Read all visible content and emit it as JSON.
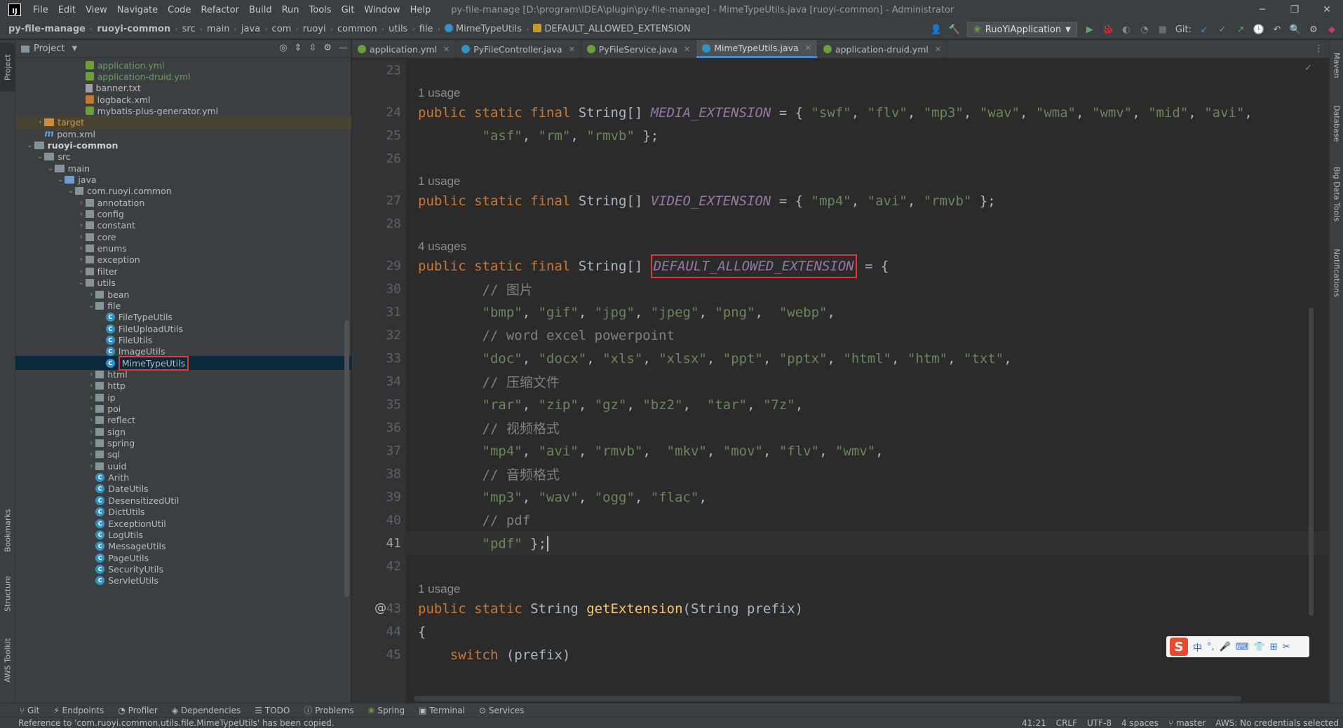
{
  "menu": [
    "File",
    "Edit",
    "View",
    "Navigate",
    "Code",
    "Refactor",
    "Build",
    "Run",
    "Tools",
    "Git",
    "Window",
    "Help"
  ],
  "window": {
    "title": "py-file-manage [D:\\program\\IDEA\\plugin\\py-file-manage] - MimeTypeUtils.java [ruoyi-common] - Administrator",
    "logo_letters": "IJ"
  },
  "breadcrumb": [
    "py-file-manage",
    "ruoyi-common",
    "src",
    "main",
    "java",
    "com",
    "ruoyi",
    "common",
    "utils",
    "file",
    "MimeTypeUtils",
    "DEFAULT_ALLOWED_EXTENSION"
  ],
  "toolbar": {
    "run_config": "RuoYiApplication",
    "git_label": "Git:"
  },
  "project_panel": {
    "title": "Project"
  },
  "left_tool_tabs": [
    "Project",
    "Bookmarks",
    "Structure",
    "AWS Toolkit"
  ],
  "right_tool_tabs": [
    "Maven",
    "Database",
    "Big Data Tools",
    "Notifications"
  ],
  "tree": [
    {
      "label": "application.yml",
      "icon": "yml-icon",
      "indent": 6,
      "style": "green"
    },
    {
      "label": "application-druid.yml",
      "icon": "yml-icon",
      "indent": 6,
      "style": "green"
    },
    {
      "label": "banner.txt",
      "icon": "text-file-icon",
      "indent": 6,
      "style": ""
    },
    {
      "label": "logback.xml",
      "icon": "xml-icon",
      "indent": 6,
      "style": ""
    },
    {
      "label": "mybatis-plus-generator.yml",
      "icon": "yml-icon",
      "indent": 6,
      "style": ""
    },
    {
      "label": "target",
      "icon": "folder-orange-icon",
      "indent": 2,
      "style": "orange",
      "arrow": "›",
      "ignored": true
    },
    {
      "label": "pom.xml",
      "icon": "maven-icon",
      "indent": 2,
      "style": ""
    },
    {
      "label": "ruoyi-common",
      "icon": "module-folder-icon",
      "indent": 1,
      "style": "bold",
      "arrow": "⌄"
    },
    {
      "label": "src",
      "icon": "folder-icon",
      "indent": 2,
      "style": "",
      "arrow": "⌄"
    },
    {
      "label": "main",
      "icon": "folder-icon",
      "indent": 3,
      "style": "",
      "arrow": "⌄"
    },
    {
      "label": "java",
      "icon": "folder-blue-icon",
      "indent": 4,
      "style": "",
      "arrow": "⌄"
    },
    {
      "label": "com.ruoyi.common",
      "icon": "package-icon",
      "indent": 5,
      "style": "",
      "arrow": "⌄"
    },
    {
      "label": "annotation",
      "icon": "package-icon",
      "indent": 6,
      "style": "",
      "arrow": "›"
    },
    {
      "label": "config",
      "icon": "package-icon",
      "indent": 6,
      "style": "",
      "arrow": "›"
    },
    {
      "label": "constant",
      "icon": "package-icon",
      "indent": 6,
      "style": "",
      "arrow": "›"
    },
    {
      "label": "core",
      "icon": "package-icon",
      "indent": 6,
      "style": "",
      "arrow": "›"
    },
    {
      "label": "enums",
      "icon": "package-icon",
      "indent": 6,
      "style": "",
      "arrow": "›"
    },
    {
      "label": "exception",
      "icon": "package-icon",
      "indent": 6,
      "style": "",
      "arrow": "›"
    },
    {
      "label": "filter",
      "icon": "package-icon",
      "indent": 6,
      "style": "",
      "arrow": "›"
    },
    {
      "label": "utils",
      "icon": "package-icon",
      "indent": 6,
      "style": "",
      "arrow": "⌄"
    },
    {
      "label": "bean",
      "icon": "package-icon",
      "indent": 7,
      "style": "",
      "arrow": "›"
    },
    {
      "label": "file",
      "icon": "package-icon",
      "indent": 7,
      "style": "",
      "arrow": "⌄"
    },
    {
      "label": "FileTypeUtils",
      "icon": "class-icon",
      "indent": 8,
      "style": ""
    },
    {
      "label": "FileUploadUtils",
      "icon": "class-icon",
      "indent": 8,
      "style": ""
    },
    {
      "label": "FileUtils",
      "icon": "class-icon",
      "indent": 8,
      "style": ""
    },
    {
      "label": "ImageUtils",
      "icon": "class-icon",
      "indent": 8,
      "style": ""
    },
    {
      "label": "MimeTypeUtils",
      "icon": "class-icon",
      "indent": 8,
      "style": "",
      "selected": true,
      "boxed": true
    },
    {
      "label": "html",
      "icon": "package-icon",
      "indent": 7,
      "style": "",
      "arrow": "›"
    },
    {
      "label": "http",
      "icon": "package-icon",
      "indent": 7,
      "style": "",
      "arrow": "›"
    },
    {
      "label": "ip",
      "icon": "package-icon",
      "indent": 7,
      "style": "",
      "arrow": "›"
    },
    {
      "label": "poi",
      "icon": "package-icon",
      "indent": 7,
      "style": "",
      "arrow": "›"
    },
    {
      "label": "reflect",
      "icon": "package-icon",
      "indent": 7,
      "style": "",
      "arrow": "›"
    },
    {
      "label": "sign",
      "icon": "package-icon",
      "indent": 7,
      "style": "",
      "arrow": "›"
    },
    {
      "label": "spring",
      "icon": "package-icon",
      "indent": 7,
      "style": "",
      "arrow": "›"
    },
    {
      "label": "sql",
      "icon": "package-icon",
      "indent": 7,
      "style": "",
      "arrow": "›"
    },
    {
      "label": "uuid",
      "icon": "package-icon",
      "indent": 7,
      "style": "",
      "arrow": "›"
    },
    {
      "label": "Arith",
      "icon": "class-icon",
      "indent": 7,
      "style": ""
    },
    {
      "label": "DateUtils",
      "icon": "class-icon",
      "indent": 7,
      "style": ""
    },
    {
      "label": "DesensitizedUtil",
      "icon": "class-icon",
      "indent": 7,
      "style": ""
    },
    {
      "label": "DictUtils",
      "icon": "class-icon",
      "indent": 7,
      "style": ""
    },
    {
      "label": "ExceptionUtil",
      "icon": "class-icon",
      "indent": 7,
      "style": ""
    },
    {
      "label": "LogUtils",
      "icon": "class-icon",
      "indent": 7,
      "style": ""
    },
    {
      "label": "MessageUtils",
      "icon": "class-icon",
      "indent": 7,
      "style": ""
    },
    {
      "label": "PageUtils",
      "icon": "class-icon",
      "indent": 7,
      "style": ""
    },
    {
      "label": "SecurityUtils",
      "icon": "class-icon",
      "indent": 7,
      "style": ""
    },
    {
      "label": "ServletUtils",
      "icon": "class-icon",
      "indent": 7,
      "style": ""
    }
  ],
  "tabs": [
    {
      "label": "application.yml",
      "icon": "yml-icon",
      "color": "#6a9f3a"
    },
    {
      "label": "PyFileController.java",
      "icon": "class-icon",
      "color": "#3592c4"
    },
    {
      "label": "PyFileService.java",
      "icon": "interface-icon",
      "color": "#6a9f3a"
    },
    {
      "label": "MimeTypeUtils.java",
      "icon": "class-icon",
      "color": "#3592c4",
      "active": true
    },
    {
      "label": "application-druid.yml",
      "icon": "yml-icon",
      "color": "#6a9f3a"
    }
  ],
  "code": {
    "usages": [
      {
        "before_line": "24",
        "text": "1 usage"
      },
      {
        "before_line": "27",
        "text": "1 usage"
      },
      {
        "before_line": "29",
        "text": "4 usages"
      },
      {
        "before_line": "43",
        "text": "1 usage"
      }
    ],
    "lines": [
      {
        "n": "23",
        "tokens": []
      },
      {
        "n": "24",
        "tokens": [
          [
            "kw",
            "public static final "
          ],
          [
            "p",
            "String[] "
          ],
          [
            "const",
            "MEDIA_EXTENSION"
          ],
          [
            "p",
            " = { "
          ],
          [
            "str",
            "\"swf\""
          ],
          [
            "p",
            ", "
          ],
          [
            "str",
            "\"flv\""
          ],
          [
            "p",
            ", "
          ],
          [
            "str",
            "\"mp3\""
          ],
          [
            "p",
            ", "
          ],
          [
            "str",
            "\"wav\""
          ],
          [
            "p",
            ", "
          ],
          [
            "str",
            "\"wma\""
          ],
          [
            "p",
            ", "
          ],
          [
            "str",
            "\"wmv\""
          ],
          [
            "p",
            ", "
          ],
          [
            "str",
            "\"mid\""
          ],
          [
            "p",
            ", "
          ],
          [
            "str",
            "\"avi\""
          ],
          [
            "p",
            ","
          ]
        ]
      },
      {
        "n": "25",
        "tokens": [
          [
            "p",
            "        "
          ],
          [
            "str",
            "\"asf\""
          ],
          [
            "p",
            ", "
          ],
          [
            "str",
            "\"rm\""
          ],
          [
            "p",
            ", "
          ],
          [
            "str",
            "\"rmvb\""
          ],
          [
            "p",
            " };"
          ]
        ]
      },
      {
        "n": "26",
        "tokens": []
      },
      {
        "n": "27",
        "tokens": [
          [
            "kw",
            "public static final "
          ],
          [
            "p",
            "String[] "
          ],
          [
            "const",
            "VIDEO_EXTENSION"
          ],
          [
            "p",
            " = { "
          ],
          [
            "str",
            "\"mp4\""
          ],
          [
            "p",
            ", "
          ],
          [
            "str",
            "\"avi\""
          ],
          [
            "p",
            ", "
          ],
          [
            "str",
            "\"rmvb\""
          ],
          [
            "p",
            " };"
          ]
        ]
      },
      {
        "n": "28",
        "tokens": []
      },
      {
        "n": "29",
        "tokens": [
          [
            "kw",
            "public static final "
          ],
          [
            "p",
            "String[] "
          ],
          [
            "boxconst",
            "DEFAULT_ALLOWED_EXTENSION"
          ],
          [
            "p",
            " = {"
          ]
        ]
      },
      {
        "n": "30",
        "tokens": [
          [
            "p",
            "        "
          ],
          [
            "cmt",
            "// 图片"
          ]
        ]
      },
      {
        "n": "31",
        "tokens": [
          [
            "p",
            "        "
          ],
          [
            "str",
            "\"bmp\""
          ],
          [
            "p",
            ", "
          ],
          [
            "str",
            "\"gif\""
          ],
          [
            "p",
            ", "
          ],
          [
            "str",
            "\"jpg\""
          ],
          [
            "p",
            ", "
          ],
          [
            "str",
            "\"jpeg\""
          ],
          [
            "p",
            ", "
          ],
          [
            "str",
            "\"png\""
          ],
          [
            "p",
            ",  "
          ],
          [
            "str",
            "\"webp\""
          ],
          [
            "p",
            ","
          ]
        ]
      },
      {
        "n": "32",
        "tokens": [
          [
            "p",
            "        "
          ],
          [
            "cmt",
            "// word excel powerpoint"
          ]
        ]
      },
      {
        "n": "33",
        "tokens": [
          [
            "p",
            "        "
          ],
          [
            "str",
            "\"doc\""
          ],
          [
            "p",
            ", "
          ],
          [
            "str",
            "\"docx\""
          ],
          [
            "p",
            ", "
          ],
          [
            "str",
            "\"xls\""
          ],
          [
            "p",
            ", "
          ],
          [
            "str",
            "\"xlsx\""
          ],
          [
            "p",
            ", "
          ],
          [
            "str",
            "\"ppt\""
          ],
          [
            "p",
            ", "
          ],
          [
            "str",
            "\"pptx\""
          ],
          [
            "p",
            ", "
          ],
          [
            "str",
            "\"html\""
          ],
          [
            "p",
            ", "
          ],
          [
            "str",
            "\"htm\""
          ],
          [
            "p",
            ", "
          ],
          [
            "str",
            "\"txt\""
          ],
          [
            "p",
            ","
          ]
        ]
      },
      {
        "n": "34",
        "tokens": [
          [
            "p",
            "        "
          ],
          [
            "cmt",
            "// 压缩文件"
          ]
        ]
      },
      {
        "n": "35",
        "tokens": [
          [
            "p",
            "        "
          ],
          [
            "str",
            "\"rar\""
          ],
          [
            "p",
            ", "
          ],
          [
            "str",
            "\"zip\""
          ],
          [
            "p",
            ", "
          ],
          [
            "str",
            "\"gz\""
          ],
          [
            "p",
            ", "
          ],
          [
            "str",
            "\"bz2\""
          ],
          [
            "p",
            ",  "
          ],
          [
            "str",
            "\"tar\""
          ],
          [
            "p",
            ", "
          ],
          [
            "str",
            "\"7z\""
          ],
          [
            "p",
            ","
          ]
        ]
      },
      {
        "n": "36",
        "tokens": [
          [
            "p",
            "        "
          ],
          [
            "cmt",
            "// 视频格式"
          ]
        ]
      },
      {
        "n": "37",
        "tokens": [
          [
            "p",
            "        "
          ],
          [
            "str",
            "\"mp4\""
          ],
          [
            "p",
            ", "
          ],
          [
            "str",
            "\"avi\""
          ],
          [
            "p",
            ", "
          ],
          [
            "str",
            "\"rmvb\""
          ],
          [
            "p",
            ",  "
          ],
          [
            "str",
            "\"mkv\""
          ],
          [
            "p",
            ", "
          ],
          [
            "str",
            "\"mov\""
          ],
          [
            "p",
            ", "
          ],
          [
            "str",
            "\"flv\""
          ],
          [
            "p",
            ", "
          ],
          [
            "str",
            "\"wmv\""
          ],
          [
            "p",
            ","
          ]
        ]
      },
      {
        "n": "38",
        "tokens": [
          [
            "p",
            "        "
          ],
          [
            "cmt",
            "// 音频格式"
          ]
        ]
      },
      {
        "n": "39",
        "tokens": [
          [
            "p",
            "        "
          ],
          [
            "str",
            "\"mp3\""
          ],
          [
            "p",
            ", "
          ],
          [
            "str",
            "\"wav\""
          ],
          [
            "p",
            ", "
          ],
          [
            "str",
            "\"ogg\""
          ],
          [
            "p",
            ", "
          ],
          [
            "str",
            "\"flac\""
          ],
          [
            "p",
            ","
          ]
        ]
      },
      {
        "n": "40",
        "tokens": [
          [
            "p",
            "        "
          ],
          [
            "cmt",
            "// pdf"
          ]
        ]
      },
      {
        "n": "41",
        "tokens": [
          [
            "p",
            "        "
          ],
          [
            "str",
            "\"pdf\""
          ],
          [
            "p",
            " };"
          ],
          [
            "caret",
            ""
          ]
        ],
        "current": true
      },
      {
        "n": "42",
        "tokens": []
      },
      {
        "n": "43",
        "tokens": [
          [
            "kw",
            "public static "
          ],
          [
            "p",
            "String "
          ],
          [
            "fn",
            "getExtension"
          ],
          [
            "p",
            "(String prefix)"
          ]
        ],
        "gutter_mark": "@"
      },
      {
        "n": "44",
        "tokens": [
          [
            "p",
            "{"
          ]
        ]
      },
      {
        "n": "45",
        "tokens": [
          [
            "p",
            "    "
          ],
          [
            "kw",
            "switch "
          ],
          [
            "p",
            "(prefix)"
          ]
        ]
      }
    ]
  },
  "ime": {
    "logo": "S",
    "items": [
      "中",
      "°,",
      "🎤",
      "⌨",
      "👕",
      "⊞",
      "✂"
    ]
  },
  "bottom_tools": [
    "Git",
    "Endpoints",
    "Profiler",
    "Dependencies",
    "TODO",
    "Problems",
    "Spring",
    "Terminal",
    "Services"
  ],
  "status": {
    "message": "Reference to 'com.ruoyi.common.utils.file.MimeTypeUtils' has been copied.",
    "position": "41:21",
    "line_sep": "CRLF",
    "encoding": "UTF-8",
    "indent": "4 spaces",
    "branch": "master",
    "aws": "AWS: No credentials selected"
  }
}
